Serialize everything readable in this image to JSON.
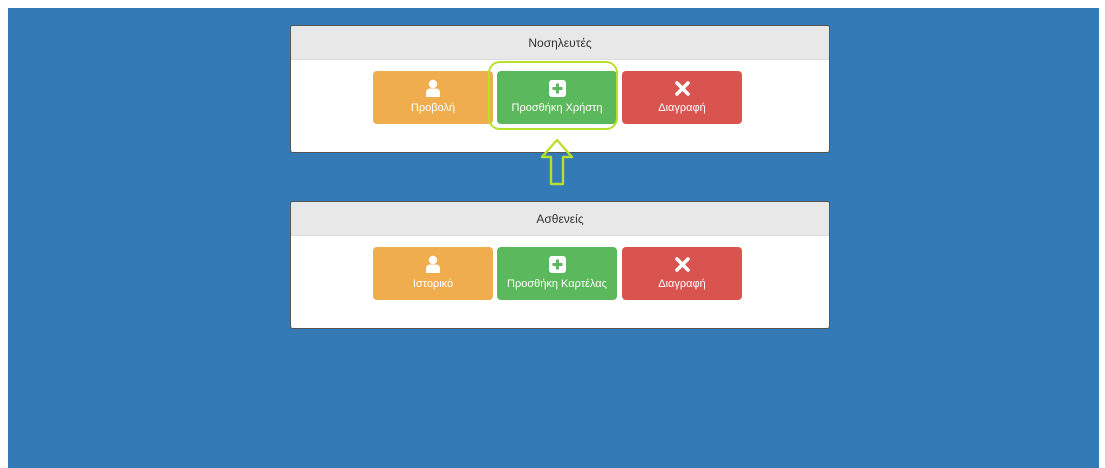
{
  "panels": [
    {
      "title": "Νοσηλευτές",
      "buttons": [
        {
          "label": "Προβολή",
          "icon": "user-icon",
          "color": "#f0ad4e"
        },
        {
          "label": "Προσθήκη Χρήστη",
          "icon": "plus-square-icon",
          "color": "#5cb85c"
        },
        {
          "label": "Διαγραφή",
          "icon": "close-icon",
          "color": "#d9534f"
        }
      ]
    },
    {
      "title": "Ασθενείς",
      "buttons": [
        {
          "label": "Ιστορικό",
          "icon": "user-icon",
          "color": "#f0ad4e"
        },
        {
          "label": "Προσθήκη Καρτέλας",
          "icon": "plus-square-icon",
          "color": "#5cb85c"
        },
        {
          "label": "Διαγραφή",
          "icon": "close-icon",
          "color": "#d9534f"
        }
      ]
    }
  ],
  "background_color": "#337ab7",
  "highlight_color": "#b8e02a"
}
